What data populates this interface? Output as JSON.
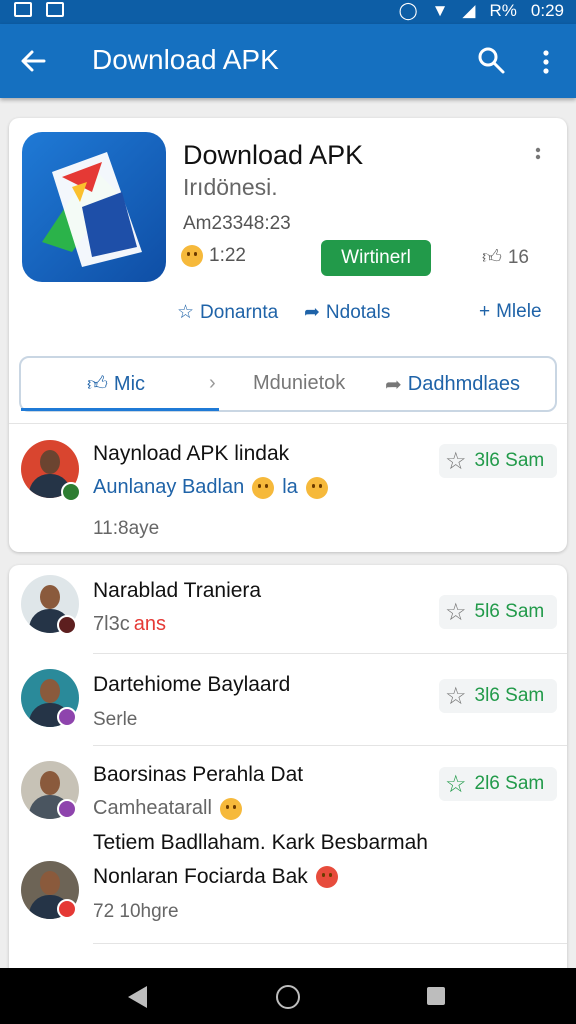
{
  "status_bar": {
    "signal_text": "R%",
    "time": "0:29"
  },
  "appbar": {
    "title": "Download APK"
  },
  "app": {
    "title": "Download APK",
    "subtitle": "Irıdönesi.",
    "version": "Am23348:23",
    "rating": "1:22",
    "install_label": "Wirtinerl",
    "likes": "16"
  },
  "actions": [
    {
      "icon": "star-outline-icon",
      "label": "Donarnta"
    },
    {
      "icon": "share-icon",
      "label": "Ndotals"
    },
    {
      "icon": "plus-icon",
      "label": "Mlele"
    }
  ],
  "tabs": [
    {
      "icon": "thumb-up-icon",
      "label": "Mic",
      "active": true
    },
    {
      "icon": "chevron-right-icon",
      "label": "Mdunietok",
      "active": false
    },
    {
      "icon": "share-icon",
      "label": "Dadhmdlaes",
      "active": false
    }
  ],
  "featured_post": {
    "name": "Naynload APK lindak",
    "line": "Aunlanay Badlan",
    "line_extra": "la",
    "time": "11:8aye",
    "rating": "3l6 Sam"
  },
  "posts": [
    {
      "name": "Narablad Traniera",
      "meta": "7l3c",
      "meta_tag": "ans",
      "rating": "5l6 Sam"
    },
    {
      "name": "Dartehiome Baylaard",
      "meta": "Serle",
      "rating": "3l6 Sam"
    },
    {
      "name": "Baorsinas Perahla Dat",
      "meta": "Camheatarall",
      "extra": "Tetiem Badllaham. Kark Besbarmah",
      "rating": "2l6 Sam"
    },
    {
      "name": "Nonlaran Fociarda Bak",
      "meta": "72 10hgre"
    }
  ],
  "colors": {
    "appbar": "#1570c0",
    "accent_green": "#229a4a",
    "link_blue": "#1f63a8"
  }
}
